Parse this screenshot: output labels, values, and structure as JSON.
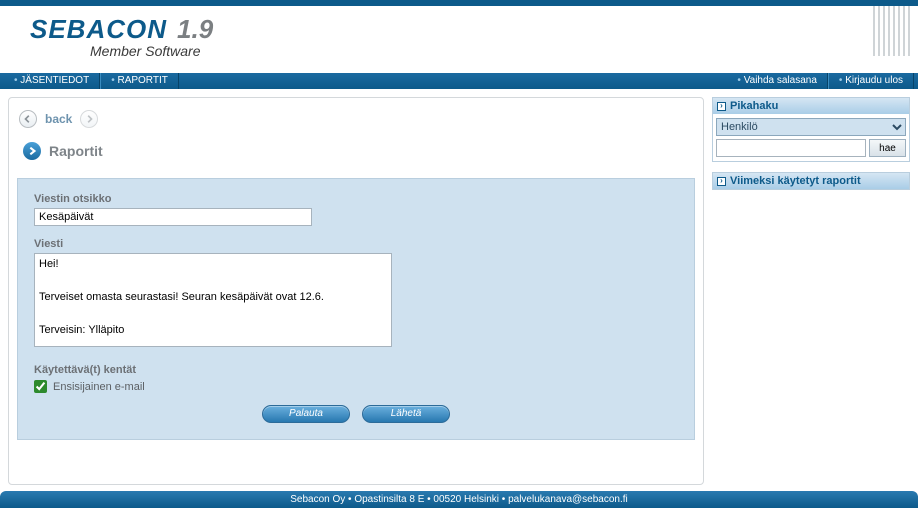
{
  "brand": {
    "name": "SEBACON",
    "version": "1.9",
    "tagline": "Member Software"
  },
  "nav": {
    "left": [
      "JÄSENTIEDOT",
      "RAPORTIT"
    ],
    "right": [
      "Vaihda salasana",
      "Kirjaudu ulos"
    ]
  },
  "back_row": {
    "label": "back"
  },
  "panel": {
    "title": "Raportit"
  },
  "form": {
    "subject_label": "Viestin otsikko",
    "subject_value": "Kesäpäivät",
    "body_label": "Viesti",
    "body_value": "Hei!\n\nTerveiset omasta seurastasi! Seuran kesäpäivät ovat 12.6.\n\nTerveisin: Ylläpito",
    "fields_label": "Käytettävä(t) kentät",
    "check1_label": "Ensisijainen e-mail",
    "check1_checked": true,
    "btn_reset": "Palauta",
    "btn_send": "Lähetä"
  },
  "sidebar": {
    "quicksearch_title": "Pikahaku",
    "quicksearch_select": "Henkilö",
    "quicksearch_btn": "hae",
    "recent_title": "Viimeksi käytetyt raportit"
  },
  "footer": "Sebacon Oy • Opastinsilta 8 E • 00520 Helsinki • palvelukanava@sebacon.fi"
}
